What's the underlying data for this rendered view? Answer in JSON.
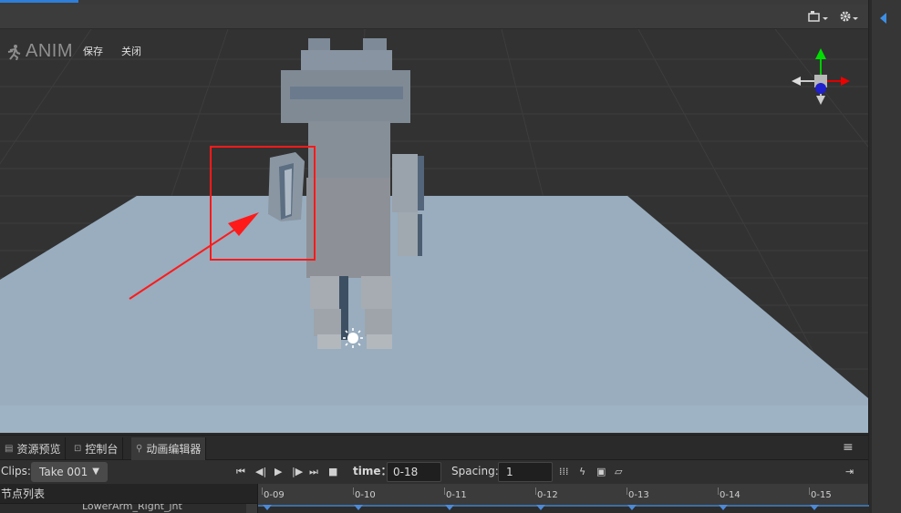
{
  "brand": {
    "name": "ANIM",
    "save": "保存",
    "close": "关闭",
    "logo_icon": "runner-icon"
  },
  "scene_toolbar": {
    "camera_icon": "camera-icon",
    "settings_icon": "gear-icon"
  },
  "colors": {
    "accent": "#2f7ed8",
    "annotation": "#ff1a1a",
    "ground": "#9eb3c4"
  },
  "dock": {
    "tabs": [
      {
        "label": "资源预览",
        "icon": "file-icon"
      },
      {
        "label": "控制台",
        "icon": "console-icon"
      },
      {
        "label": "动画编辑器",
        "icon": "runner-icon"
      }
    ],
    "menu_icon": "hamburger-icon"
  },
  "controls": {
    "clips_label": "Clips:",
    "clip_selected": "Take 001",
    "time_label": "time：",
    "time_value": "0-18",
    "spacing_label": "Spacing:",
    "spacing_value": "1"
  },
  "nodes": {
    "header": "节点列表",
    "partial_row": "LowerArm_Right_jnt"
  },
  "timeline": {
    "ticks": [
      "0-09",
      "0-10",
      "0-11",
      "0-12",
      "0-13",
      "0-14",
      "0-15"
    ]
  }
}
